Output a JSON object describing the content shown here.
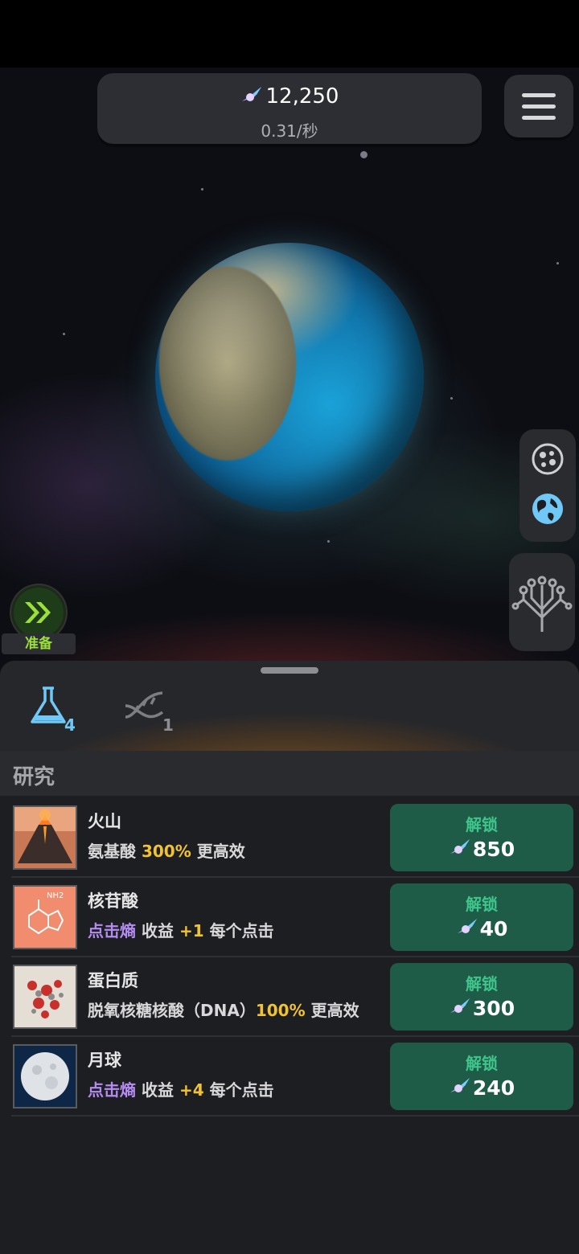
{
  "header": {
    "currency_amount": "12,250",
    "currency_rate": "0.31/秒"
  },
  "ready_button": {
    "label": "准备"
  },
  "tabs": [
    {
      "name": "research",
      "count": "4"
    },
    {
      "name": "dna",
      "count": "1"
    }
  ],
  "section": {
    "title": "研究"
  },
  "research_items": [
    {
      "title": "火山",
      "desc_parts": [
        {
          "text": "氨基酸 ",
          "style": "w"
        },
        {
          "text": "300%",
          "style": "y"
        },
        {
          "text": " 更高效",
          "style": "w"
        }
      ],
      "button_label": "解锁",
      "price": "850",
      "thumb": "volcano"
    },
    {
      "title": "核苷酸",
      "desc_parts": [
        {
          "text": "点击熵",
          "style": "p"
        },
        {
          "text": " 收益 ",
          "style": "w"
        },
        {
          "text": "+1",
          "style": "y"
        },
        {
          "text": " 每个点击",
          "style": "w"
        }
      ],
      "button_label": "解锁",
      "price": "40",
      "thumb": "nucleotide"
    },
    {
      "title": "蛋白质",
      "desc_parts": [
        {
          "text": "脱氧核糖核酸（DNA）",
          "style": "w"
        },
        {
          "text": "100%",
          "style": "y"
        },
        {
          "text": " 更高效",
          "style": "w"
        }
      ],
      "button_label": "解锁",
      "price": "300",
      "thumb": "protein"
    },
    {
      "title": "月球",
      "desc_parts": [
        {
          "text": "点击熵",
          "style": "p"
        },
        {
          "text": " 收益 ",
          "style": "w"
        },
        {
          "text": "+4",
          "style": "y"
        },
        {
          "text": " 每个点击",
          "style": "w"
        }
      ],
      "button_label": "解锁",
      "price": "240",
      "thumb": "moon"
    }
  ],
  "colors": {
    "accent_green": "#9be03a",
    "unlock_bg": "#1f5c47",
    "unlock_text": "#3fc58c",
    "highlight_yellow": "#f1c232",
    "highlight_purple": "#b48cf0"
  },
  "icons": [
    "gem-icon",
    "menu-icon",
    "cells-icon",
    "globe-icon",
    "tree-icon",
    "fast-forward-icon",
    "flask-icon",
    "dna-icon"
  ]
}
